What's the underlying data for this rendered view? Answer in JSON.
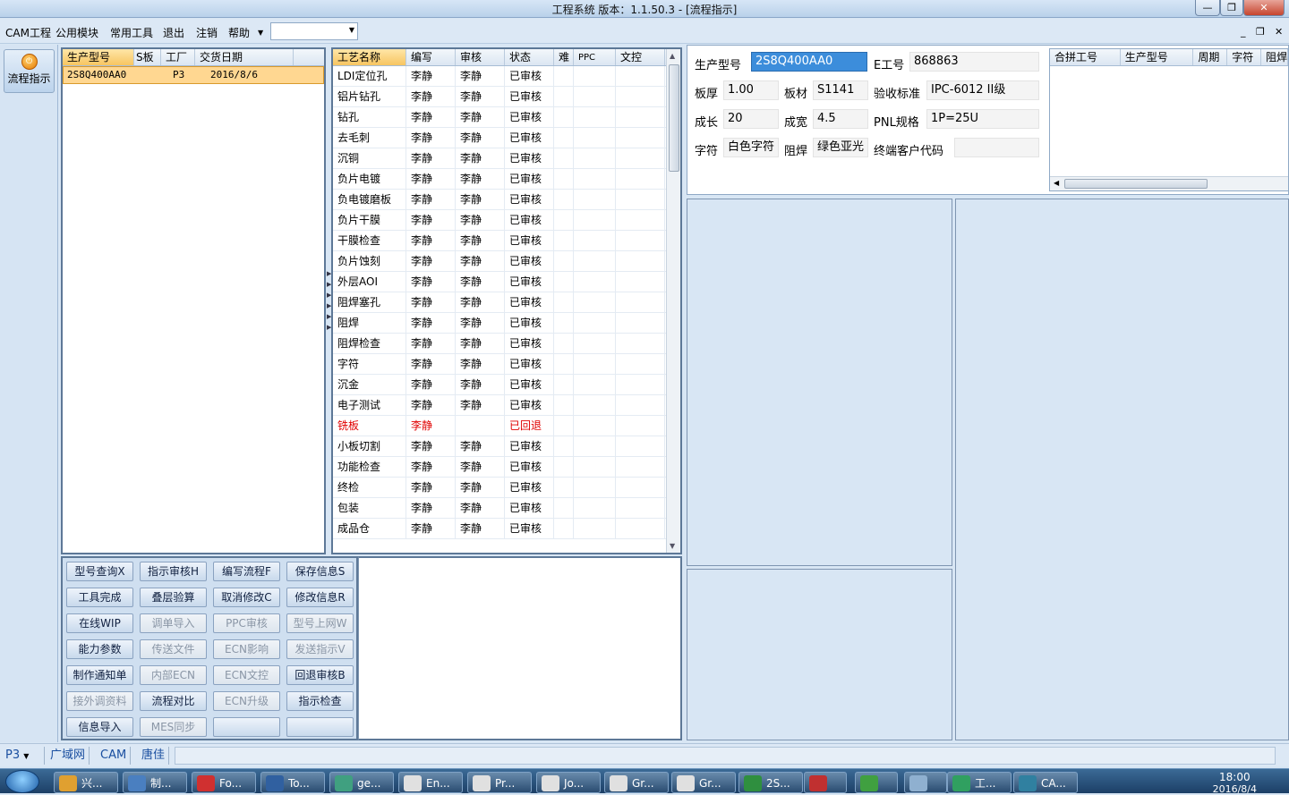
{
  "window": {
    "title": "工程系统    版本：1.1.50.3 - [流程指示]",
    "minimize": "—",
    "maximize": "❐",
    "close": "✕"
  },
  "menu": {
    "items": [
      "CAM工程",
      "公用模块",
      "常用工具",
      "退出",
      "注销",
      "帮助"
    ],
    "combo_value": "",
    "mdi": {
      "min": "_",
      "restore": "❐",
      "close": "✕"
    }
  },
  "nav": {
    "flow_button": "流程指示"
  },
  "product_grid": {
    "headers": [
      "生产型号",
      "S板",
      "工厂",
      "交货日期"
    ],
    "rows": [
      {
        "model": "2S8Q400AA0",
        "s": "",
        "factory": "P3",
        "date": "2016/8/6"
      }
    ]
  },
  "process_grid": {
    "headers": [
      "工艺名称",
      "编写",
      "审核",
      "状态",
      "难",
      "PPC",
      "文控"
    ],
    "rows": [
      [
        "LDI定位孔",
        "李静",
        "李静",
        "已审核"
      ],
      [
        "铝片钻孔",
        "李静",
        "李静",
        "已审核"
      ],
      [
        "钻孔",
        "李静",
        "李静",
        "已审核"
      ],
      [
        "去毛刺",
        "李静",
        "李静",
        "已审核"
      ],
      [
        "沉铜",
        "李静",
        "李静",
        "已审核"
      ],
      [
        "负片电镀",
        "李静",
        "李静",
        "已审核"
      ],
      [
        "负电镀磨板",
        "李静",
        "李静",
        "已审核"
      ],
      [
        "负片干膜",
        "李静",
        "李静",
        "已审核"
      ],
      [
        "干膜检查",
        "李静",
        "李静",
        "已审核"
      ],
      [
        "负片蚀刻",
        "李静",
        "李静",
        "已审核"
      ],
      [
        "外层AOI",
        "李静",
        "李静",
        "已审核"
      ],
      [
        "阻焊塞孔",
        "李静",
        "李静",
        "已审核"
      ],
      [
        "阻焊",
        "李静",
        "李静",
        "已审核"
      ],
      [
        "阻焊检查",
        "李静",
        "李静",
        "已审核"
      ],
      [
        "字符",
        "李静",
        "李静",
        "已审核"
      ],
      [
        "沉金",
        "李静",
        "李静",
        "已审核"
      ],
      [
        "电子测试",
        "李静",
        "李静",
        "已审核"
      ],
      [
        "铣板",
        "李静",
        "",
        "已回退"
      ],
      [
        "小板切割",
        "李静",
        "李静",
        "已审核"
      ],
      [
        "功能检查",
        "李静",
        "李静",
        "已审核"
      ],
      [
        "终检",
        "李静",
        "李静",
        "已审核"
      ],
      [
        "包装",
        "李静",
        "李静",
        "已审核"
      ],
      [
        "成品仓",
        "李静",
        "李静",
        "已审核"
      ]
    ],
    "highlight_row_index": 17,
    "highlight_color": "#e00000"
  },
  "actions": [
    [
      "型号查询X",
      "指示审核H",
      "编写流程F",
      "保存信息S"
    ],
    [
      "工具完成",
      "叠层验算",
      "取消修改C",
      "修改信息R"
    ],
    [
      "在线WIP",
      "调单导入",
      "PPC审核",
      "型号上网W"
    ],
    [
      "能力参数",
      "传送文件",
      "ECN影响",
      "发送指示V"
    ],
    [
      "制作通知单",
      "内部ECN",
      "ECN文控",
      "回退审核B"
    ],
    [
      "接外调资料",
      "流程对比",
      "ECN升级",
      "指示检查"
    ],
    [
      "信息导入",
      "MES同步",
      "",
      ""
    ]
  ],
  "actions_disabled": [
    "调单导入",
    "PPC审核",
    "型号上网W",
    "传送文件",
    "ECN影响",
    "发送指示V",
    "内部ECN",
    "ECN文控",
    "接外调资料",
    "ECN升级",
    "MES同步"
  ],
  "info": {
    "model_label": "生产型号",
    "model": "2S8Q400AA0",
    "e_label": "E工号",
    "e_no": "868863",
    "thick_label": "板厚",
    "thick": "1.00",
    "mat_label": "板材",
    "mat": "S1141",
    "std_label": "验收标准",
    "std": "IPC-6012 II级",
    "len_label": "成长",
    "len": "20",
    "wid_label": "成宽",
    "wid": "4.5",
    "pnl_label": "PNL规格",
    "pnl": "1P=25U",
    "char_label": "字符",
    "char": "白色字符",
    "mask_label": "阻焊",
    "mask": "绿色亚光",
    "cust_label": "终端客户代码",
    "cust": ""
  },
  "merge_grid": {
    "headers": [
      "合拼工号",
      "生产型号",
      "周期",
      "字符",
      "阻焊"
    ]
  },
  "status": {
    "factory": "P3",
    "items": [
      "广域网",
      "CAM",
      "唐佳"
    ]
  },
  "taskbar": {
    "tasks": [
      "兴...",
      "制...",
      "Fo...",
      "To...",
      "ge...",
      "En...",
      "Pr...",
      "Jo...",
      "Gr...",
      "Gr...",
      "2S...",
      "",
      "",
      "",
      "工...",
      "CA..."
    ],
    "clock": "18:00",
    "date": "2016/8/4"
  }
}
